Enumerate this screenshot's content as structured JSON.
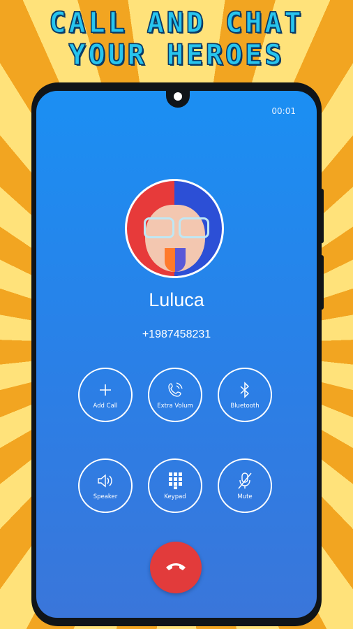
{
  "headline": {
    "line1": "CALL AND CHAT",
    "line2": "YOUR HEROES"
  },
  "status": {
    "timer": "00:01"
  },
  "contact": {
    "name": "Luluca",
    "number": "+1987458231"
  },
  "controls": [
    {
      "label": "Add Call",
      "icon": "plus-icon"
    },
    {
      "label": "Extra Volum",
      "icon": "phone-volume-icon"
    },
    {
      "label": "Bluetooth",
      "icon": "bluetooth-icon"
    },
    {
      "label": "Speaker",
      "icon": "speaker-icon"
    },
    {
      "label": "Keypad",
      "icon": "keypad-icon"
    },
    {
      "label": "Mute",
      "icon": "mic-off-icon"
    }
  ],
  "end_call": {
    "icon": "end-call-icon",
    "color": "#e23b3b"
  },
  "colors": {
    "screen": "#2b7fe6",
    "headline": "#27c5ee",
    "background": "#f6b92a"
  }
}
